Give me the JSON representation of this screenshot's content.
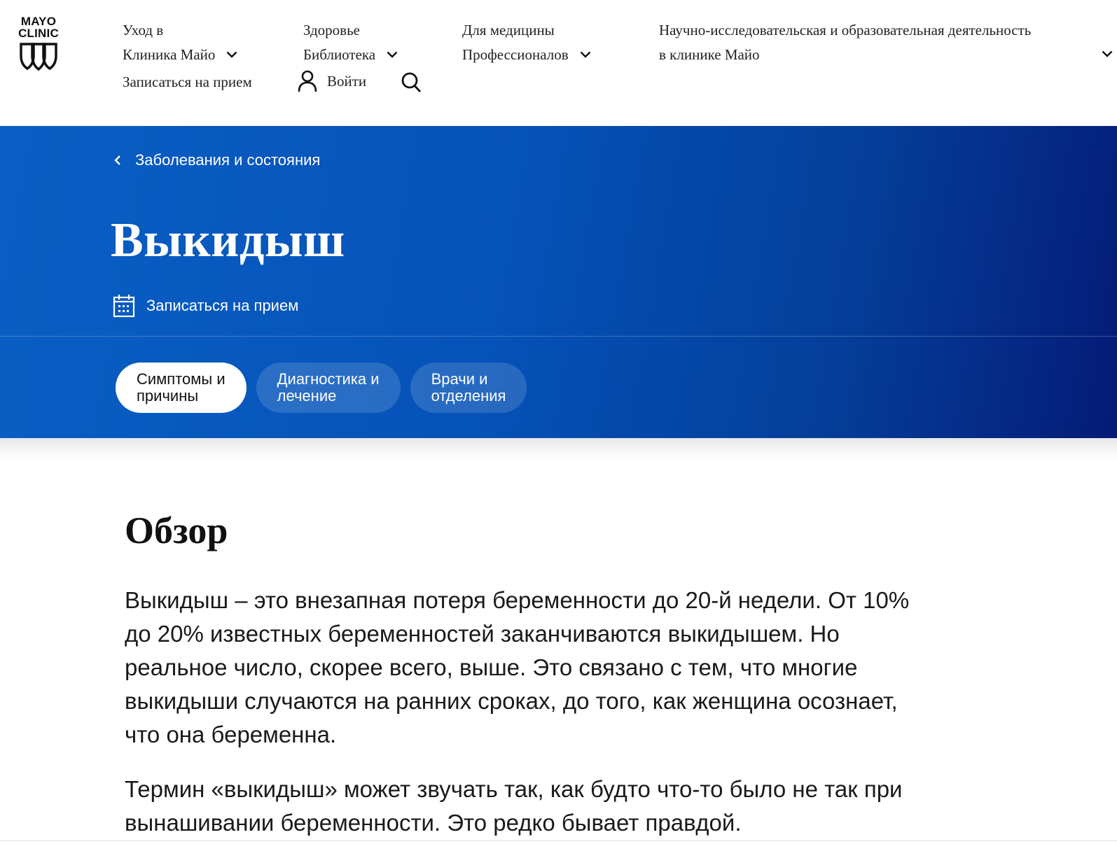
{
  "logo": {
    "line1": "MAYO",
    "line2": "CLINIC"
  },
  "nav": {
    "care": {
      "line1": "Уход в",
      "line2": "Клиника Майо"
    },
    "health": {
      "line1": "Здоровье",
      "line2": "Библиотека"
    },
    "pros": {
      "line1": "Для медицины",
      "line2": "Профессионалов"
    },
    "research": {
      "line1": "Научно-исследовательская и образовательная деятельность",
      "line2": "в клинике Майо"
    },
    "appointment": "Записаться на прием",
    "login": "Войти"
  },
  "hero": {
    "breadcrumb": "Заболевания и состояния",
    "title": "Выкидыш",
    "appointment": "Записаться на прием",
    "tabs": [
      {
        "line1": "Симптомы и",
        "line2": "причины",
        "active": true
      },
      {
        "line1": "Диагностика и",
        "line2": "лечение",
        "active": false
      },
      {
        "line1": "Врачи и",
        "line2": "отделения",
        "active": false
      }
    ]
  },
  "content": {
    "heading": "Обзор",
    "paragraphs": [
      "Выкидыш – это внезапная потеря беременности до 20-й недели. От 10% до 20% известных беременностей заканчиваются выкидышем. Но реальное число, скорее всего, выше. Это связано с тем, что многие выкидыши случаются на ранних сроках, до того, как женщина осознает, что она беременна.",
      "Термин «выкидыш» может звучать так, как будто что-то было не так при вынашивании беременности. Это редко бывает правдой."
    ]
  },
  "colors": {
    "hero_start": "#0a5fc4",
    "hero_end": "#041b77",
    "tab_active_bg": "#ffffff"
  }
}
